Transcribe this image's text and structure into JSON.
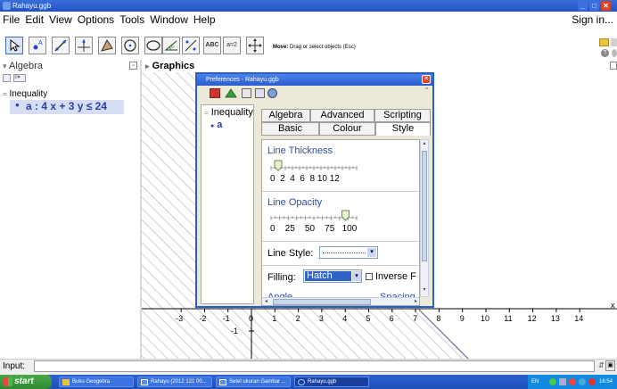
{
  "window": {
    "title": "Rahayu.ggb"
  },
  "menu": {
    "items": [
      "File",
      "Edit",
      "View",
      "Options",
      "Tools",
      "Window",
      "Help"
    ],
    "sign_in": "Sign in..."
  },
  "toolbar": {
    "move_hint_bold": "Move:",
    "move_hint": "Drag or select objects (Esc)",
    "text_tool": "ABC",
    "slider_tool": "a=2"
  },
  "algebra": {
    "header": "Algebra",
    "category": "Inequality",
    "item": "a : 4 x + 3 y ≤ 24"
  },
  "graphics": {
    "header": "Graphics",
    "x_ticks": [
      "-3",
      "-2",
      "-1",
      "0",
      "1",
      "2",
      "3",
      "4",
      "5",
      "6",
      "7",
      "8",
      "9",
      "10",
      "11",
      "12",
      "13",
      "14"
    ],
    "y_ticks": [
      "-1"
    ],
    "x_axis_label": "x"
  },
  "prefs": {
    "title": "Preferences - Rahayu.ggb",
    "tree_category": "Inequality",
    "tree_item": "a",
    "tabs_row1": [
      "Algebra",
      "Advanced",
      "Scripting"
    ],
    "tabs_row2": [
      "Basic",
      "Colour",
      "Style"
    ],
    "line_thickness_label": "Line Thickness",
    "thickness_scale": "0  2  4  6  8 10 12",
    "line_opacity_label": "Line Opacity",
    "opacity_scale": "0    25    50    75   100",
    "line_style_label": "Line Style:",
    "filling_label": "Filling:",
    "filling_value": "Hatch",
    "inverse_label": "Inverse F",
    "angle_label": "Angle",
    "spacing_label": "Spacing",
    "thickness_value": 1,
    "opacity_value": 0.87
  },
  "input": {
    "label": "Input:"
  },
  "taskbar": {
    "start": "start",
    "tasks": [
      "Buku Geogebra",
      "Rahayu (2012 121 00...",
      "Setel ukuran Gambar ...",
      "Rahayu.ggb"
    ],
    "lang": "EN",
    "clock": "16:54"
  }
}
